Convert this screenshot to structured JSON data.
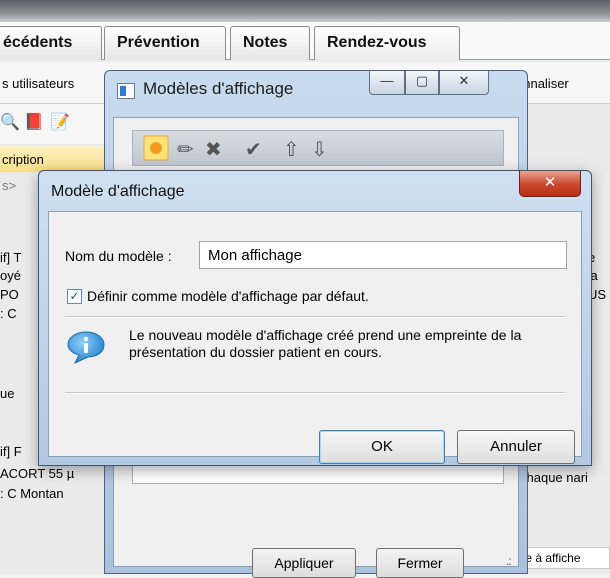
{
  "background": {
    "tabs": [
      "écédents",
      "Prévention",
      "Notes",
      "Rendez-vous"
    ],
    "toolbar_label": "s utilisateurs",
    "toolbar_right": "onnaliser",
    "desc_label": "cription",
    "s_label": "s>",
    "left_fragments": [
      "if] T",
      "oyé",
      "PO",
      ": C",
      "ue",
      "if] F"
    ],
    "right_fragments": [
      "e",
      "'a",
      "US"
    ],
    "bottom_left_1": "ACORT 55 µ",
    "bottom_left_2": ": C  Montan",
    "bottom_right_1": "chaque nari",
    "bottom_right_2": "xte à affiche"
  },
  "modeles_window": {
    "title": "Modèles d'affichage",
    "minimize_glyph": "—",
    "maximize_glyph": "▢",
    "close_glyph": "✕",
    "apply_label": "Appliquer",
    "close_label": "Fermer"
  },
  "dialog": {
    "title": "Modèle d'affichage",
    "close_glyph": "✕",
    "name_label": "Nom du modèle :",
    "name_value": "Mon affichage",
    "default_checkbox_label": "Définir comme modèle d'affichage par défaut.",
    "default_checked": true,
    "info_text": "Le nouveau modèle d'affichage créé prend une empreinte de la présentation du dossier patient en cours.",
    "ok_label": "OK",
    "cancel_label": "Annuler"
  },
  "colors": {
    "title_bar": "#b2c9e2",
    "close_button": "#c9452c",
    "info_icon": "#2e8fd6"
  }
}
